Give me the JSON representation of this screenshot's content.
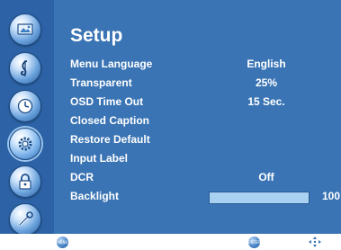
{
  "menu": {
    "title": "Setup",
    "items": [
      {
        "label": "Menu Language",
        "value": "English"
      },
      {
        "label": "Transparent",
        "value": "25%"
      },
      {
        "label": "OSD Time Out",
        "value": "15 Sec."
      },
      {
        "label": "Closed Caption",
        "value": ""
      },
      {
        "label": "Restore Default",
        "value": ""
      },
      {
        "label": "Input Label",
        "value": ""
      },
      {
        "label": "DCR",
        "value": "Off"
      }
    ],
    "backlight": {
      "label": "Backlight",
      "value": "100",
      "level": 1.0
    }
  },
  "sidebar": {
    "icons": [
      {
        "name": "picture-icon"
      },
      {
        "name": "audio-icon"
      },
      {
        "name": "timer-icon"
      },
      {
        "name": "setup-icon",
        "active": true
      },
      {
        "name": "lock-icon"
      },
      {
        "name": "tools-icon"
      }
    ]
  },
  "footer": {
    "buttons": [
      {
        "label": "MENU",
        "icon": "menu-button-icon"
      },
      {
        "label": "ENTER",
        "icon": "enter-button-icon"
      }
    ],
    "nav_icon": "navigation-arrows-icon"
  },
  "colors": {
    "background": "#3a74b4",
    "sidebar": "#2d63a6",
    "text": "#ffffff",
    "bar_fill": "#a8d0f0"
  }
}
